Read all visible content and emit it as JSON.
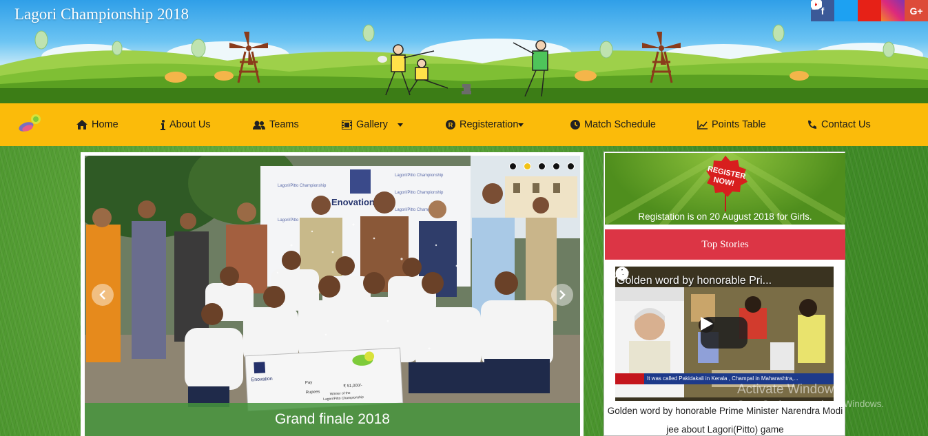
{
  "site": {
    "title": "Lagori Championship 2018"
  },
  "social": [
    {
      "name": "facebook-icon",
      "glyph": "f",
      "color": "#3b5998"
    },
    {
      "name": "twitter-icon",
      "glyph": "t",
      "color": "#1da1f2"
    },
    {
      "name": "youtube-icon",
      "glyph": "▶",
      "color": "#e62117"
    },
    {
      "name": "instagram-icon",
      "glyph": "◎",
      "color": "#c13584"
    },
    {
      "name": "google-plus-icon",
      "glyph": "G+",
      "color": "#dd4b39"
    }
  ],
  "nav": {
    "background": "#fbbb0a",
    "items": [
      {
        "label": "Home",
        "icon": "home-icon"
      },
      {
        "label": "About Us",
        "icon": "info-icon"
      },
      {
        "label": "Teams",
        "icon": "users-icon"
      },
      {
        "label": "Gallery",
        "icon": "film-icon",
        "dropdown": true
      },
      {
        "label": "Registeration",
        "icon": "registered-icon",
        "dropdown": true
      },
      {
        "label": "Match Schedule",
        "icon": "clock-icon"
      },
      {
        "label": "Points Table",
        "icon": "chart-icon"
      },
      {
        "label": "Contact Us",
        "icon": "phone-icon"
      }
    ]
  },
  "carousel": {
    "caption": "Grand finale 2018",
    "slide_count": 5,
    "active_index": 1,
    "banner_text": "Lagori/Pitto Championship",
    "sponsor": "Enovation",
    "cheque": {
      "brand": "Enovation",
      "pay_label": "Pay",
      "rupees_label": "Rupees",
      "amount": "₹ 51,000/-",
      "line": "Winner of the",
      "event": "Lagori/Pitto Championship"
    }
  },
  "sidebar": {
    "register_badge": "REGISTER NOW!",
    "registration_notice": "Registation is on 20 August 2018 for Girls.",
    "top_stories_label": "Top Stories",
    "video": {
      "title": "Golden word by honorable Pri...",
      "ticker": "It was called Pakidakali in Kerala , Champal in Maharashtra,..."
    },
    "video_description": "Golden word by honorable Prime Minister Narendra Modi jee about Lagori(Pitto) game"
  },
  "watermark": {
    "line1": "Activate Windows",
    "line2": "Go to Settings to activate Windows."
  },
  "colors": {
    "top_stories": "#dc3545",
    "caption_bg": "#45943c",
    "accent_dot": "#f2c318"
  }
}
